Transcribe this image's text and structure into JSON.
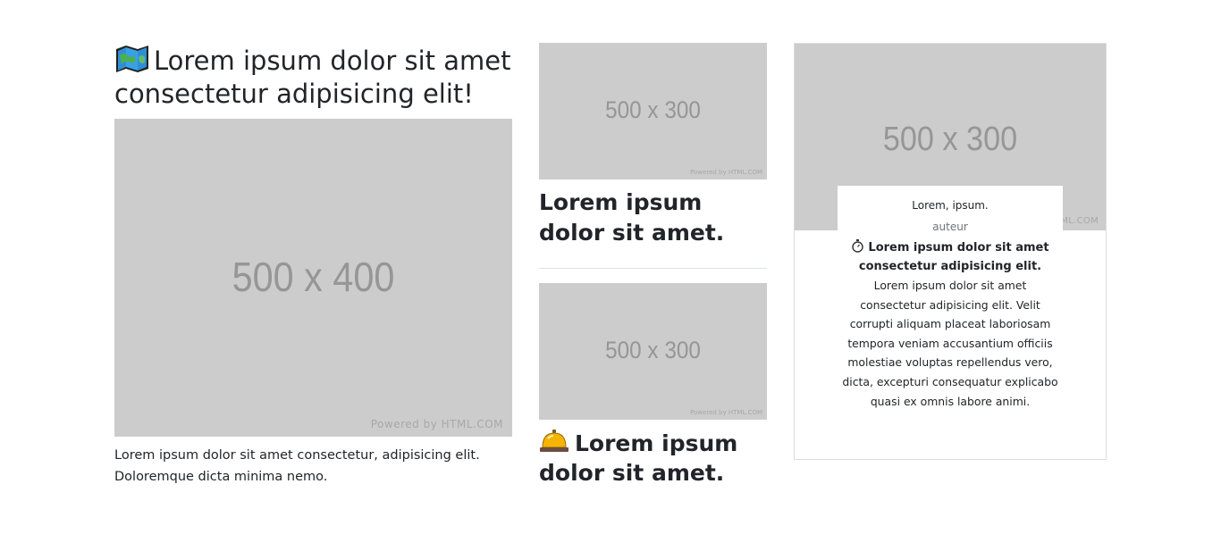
{
  "column1": {
    "title": "Lorem ipsum dolor sit amet consectetur adipisicing elit!",
    "title_icon": "map-icon",
    "image": {
      "dimensions": "500 x 400",
      "credit": "Powered by HTML.COM"
    },
    "text": "Lorem ipsum dolor sit amet consectetur, adipisicing elit. Doloremque dicta minima nemo."
  },
  "column2": {
    "item1": {
      "image": {
        "dimensions": "500 x 300",
        "credit": "Powered by HTML.COM"
      },
      "title": "Lorem ipsum dolor sit amet."
    },
    "item2": {
      "image": {
        "dimensions": "500 x 300",
        "credit": "Powered by HTML.COM"
      },
      "title": "Lorem ipsum dolor sit amet.",
      "title_icon": "bellhop-bell-icon"
    }
  },
  "card": {
    "image": {
      "dimensions": "500 x 300",
      "credit": "Powered by HTML.COM"
    },
    "name": "Lorem, ipsum.",
    "role": "auteur",
    "heading_icon": "stopwatch-icon",
    "heading": "Lorem ipsum dolor sit amet consectetur adipisicing elit.",
    "text": "Lorem ipsum dolor sit amet consectetur adipisicing elit. Velit corrupti aliquam placeat laboriosam tempora veniam accusantium officiis molestiae voluptas repellendus vero, dicta, excepturi consequatur explicabo quasi ex omnis labore animi."
  },
  "colors": {
    "placeholder_bg": "#cccccc",
    "placeholder_text": "#969696",
    "text": "#212529",
    "muted": "#6c757d",
    "rule": "#dee2e6"
  }
}
